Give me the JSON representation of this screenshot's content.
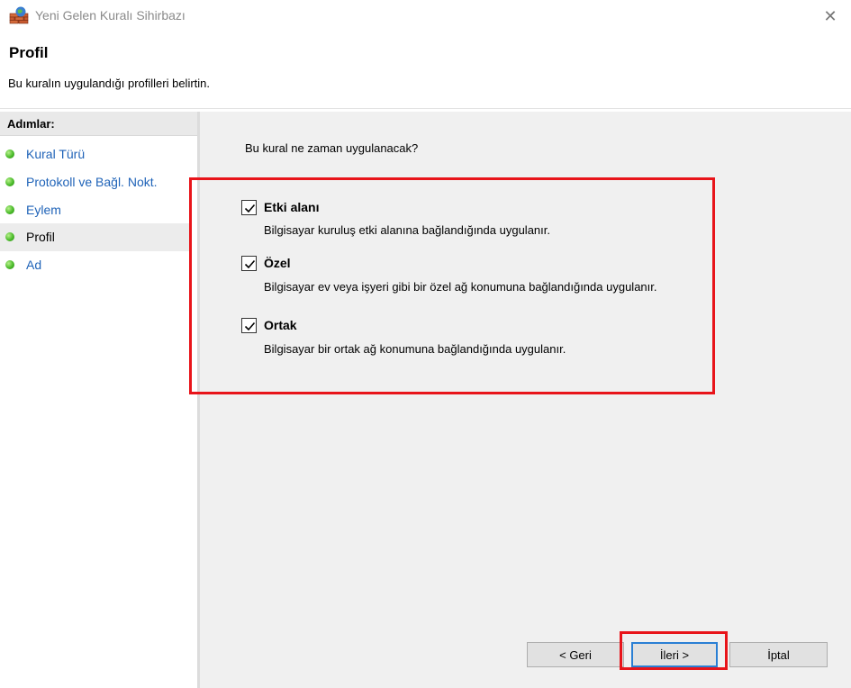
{
  "window": {
    "title": "Yeni Gelen Kuralı Sihirbazı",
    "close_glyph": "✕"
  },
  "header": {
    "title": "Profil",
    "description": "Bu kuralın uygulandığı profilleri belirtin."
  },
  "sidebar": {
    "heading": "Adımlar:",
    "items": [
      {
        "label": "Kural Türü",
        "active": false
      },
      {
        "label": "Protokoll ve Bağl. Nokt.",
        "active": false
      },
      {
        "label": "Eylem",
        "active": false
      },
      {
        "label": "Profil",
        "active": true
      },
      {
        "label": "Ad",
        "active": false
      }
    ]
  },
  "main": {
    "question": "Bu kural ne zaman uygulanacak?",
    "options": [
      {
        "title": "Etki alanı",
        "description": "Bilgisayar kuruluş etki alanına bağlandığında uygulanır.",
        "checked": true
      },
      {
        "title": "Özel",
        "description": "Bilgisayar ev veya işyeri gibi bir özel ağ konumuna bağlandığında uygulanır.",
        "checked": true
      },
      {
        "title": "Ortak",
        "description": "Bilgisayar bir ortak ağ konumuna bağlandığında uygulanır.",
        "checked": true
      }
    ]
  },
  "footer": {
    "back_label": "< Geri",
    "next_label": "İleri >",
    "cancel_label": "İptal"
  },
  "colors": {
    "highlight": "#e8141a",
    "link": "#1f63b8",
    "panel_bg": "#f0f0f0"
  }
}
